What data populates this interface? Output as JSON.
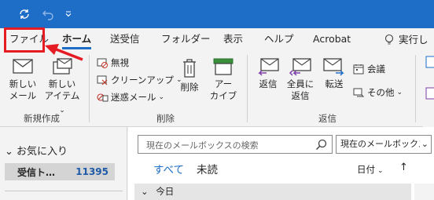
{
  "tabs": {
    "file": "ファイル",
    "home": "ホーム",
    "send_receive": "送受信",
    "folder": "フォルダー",
    "view": "表示",
    "help": "ヘルプ",
    "acrobat": "Acrobat",
    "tell_me": "実行し"
  },
  "ribbon": {
    "new_group": {
      "label": "新規作成",
      "new_mail_line1": "新しい",
      "new_mail_line2": "メール",
      "new_items_line1": "新しい",
      "new_items_line2": "アイテム"
    },
    "delete_group": {
      "label": "削除",
      "ignore": "無視",
      "cleanup": "クリーンアップ",
      "junk": "迷惑メール",
      "delete": "削除",
      "archive_line1": "アー",
      "archive_line2": "カイブ"
    },
    "respond_group": {
      "label": "返信",
      "reply": "返信",
      "reply_all_line1": "全員に",
      "reply_all_line2": "返信",
      "forward": "転送",
      "meeting": "会議",
      "more": "その他"
    }
  },
  "sidebar": {
    "favorites": "お気に入り",
    "inbox_label": "受信ト…",
    "inbox_count": "11395"
  },
  "main": {
    "search_placeholder": "現在のメールボックスの検索",
    "scope": "現在のメールボックス",
    "filter_all": "すべて",
    "filter_unread": "未読",
    "sort_by": "日付",
    "group_today": "今日"
  },
  "colors": {
    "title_bar": "#1e6ec8",
    "highlight": "#e51c23",
    "accent": "#1e6ec8"
  }
}
